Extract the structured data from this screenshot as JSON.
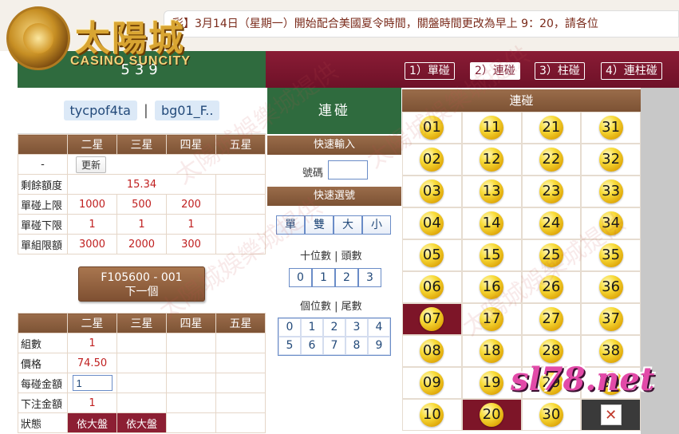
{
  "header": {
    "logo_cn": "太陽城",
    "logo_en": "CASINO SUNCITY",
    "marquee": "彩】3月14日（星期一）開始配合美國夏令時間，關盤時間更改為早上 9：20，請各位"
  },
  "left": {
    "game_title": "539",
    "user1": "tycpof4ta",
    "separator": "|",
    "user2": "bg01_F..",
    "table1": {
      "headers": [
        "",
        "二星",
        "三星",
        "四星",
        "五星"
      ],
      "update_row_dash": "-",
      "update_label": "更新",
      "rows": [
        {
          "label": "剩餘額度",
          "values": [
            "15.34"
          ]
        },
        {
          "label": "單碰上限",
          "values": [
            "1000",
            "500",
            "200",
            ""
          ]
        },
        {
          "label": "單碰下限",
          "values": [
            "1",
            "1",
            "1",
            ""
          ]
        },
        {
          "label": "單組限額",
          "values": [
            "3000",
            "2000",
            "300",
            ""
          ]
        }
      ]
    },
    "next_button": {
      "code": "F105600 - 001",
      "label": "下一個"
    },
    "table2": {
      "headers": [
        "",
        "二星",
        "三星",
        "四星",
        "五星"
      ],
      "rows": [
        {
          "label": "組數",
          "values": [
            "1",
            "",
            "",
            ""
          ]
        },
        {
          "label": "價格",
          "values": [
            "74.50",
            "",
            "",
            ""
          ]
        },
        {
          "label": "每碰金額",
          "input_value": "1"
        },
        {
          "label": "下注金額",
          "values": [
            "1",
            "",
            "",
            ""
          ]
        },
        {
          "label": "狀態",
          "values": [
            "依大盤",
            "依大盤",
            "",
            ""
          ]
        }
      ]
    }
  },
  "tabs": [
    {
      "label": "1）單碰",
      "active": false
    },
    {
      "label": "2）連碰",
      "active": true
    },
    {
      "label": "3）柱碰",
      "active": false
    },
    {
      "label": "4）連柱碰",
      "active": false
    }
  ],
  "middle": {
    "title": "連碰",
    "quick_input_header": "快速輸入",
    "haoma_label": "號碼",
    "haoma_value": "",
    "quick_select_header": "快速選號",
    "quick_buttons": [
      "單",
      "雙",
      "大",
      "小"
    ],
    "tens_label": "十位數 | 頭數",
    "tens_buttons": [
      "0",
      "1",
      "2",
      "3"
    ],
    "units_label": "個位數 | 尾數",
    "units_buttons": [
      "0",
      "1",
      "2",
      "3",
      "4",
      "5",
      "6",
      "7",
      "8",
      "9"
    ]
  },
  "balls": {
    "header": "連碰",
    "numbers": [
      "01",
      "11",
      "21",
      "31",
      "02",
      "12",
      "22",
      "32",
      "03",
      "13",
      "23",
      "33",
      "04",
      "14",
      "24",
      "34",
      "05",
      "15",
      "25",
      "35",
      "06",
      "16",
      "26",
      "36",
      "07",
      "17",
      "27",
      "37",
      "08",
      "18",
      "28",
      "38",
      "09",
      "19",
      "29",
      "39",
      "10",
      "20",
      "30",
      ""
    ],
    "selected": [
      "07",
      "20"
    ],
    "clear_icon": "close-icon"
  },
  "watermarks": {
    "site": "sl78.net",
    "text": "太陽城娛樂城提供"
  }
}
